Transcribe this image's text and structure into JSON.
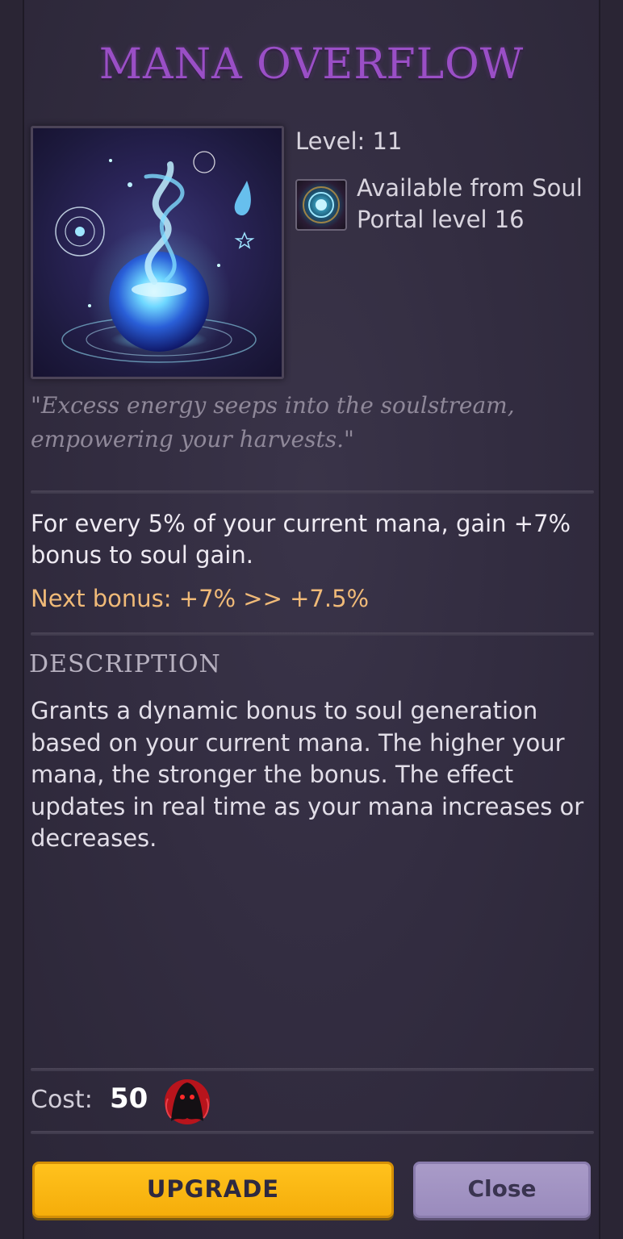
{
  "title": "Mana Overflow",
  "level": "Level: 11",
  "availability": "Available from Soul Portal level 16",
  "flavor_text": "\"Excess energy seeps into the soulstream, empowering your harvests.\"",
  "effect_text": "For every 5% of your current mana, gain +7% bonus to soul gain.",
  "next_bonus": "Next bonus: +7% >> +7.5%",
  "description_heading": "Description",
  "description_text": "Grants a dynamic bonus to soul generation based on your current mana. The higher your mana, the stronger the bonus. The effect updates in real time as your mana increases or decreases.",
  "cost": {
    "label": "Cost:",
    "value": "50",
    "currency_icon": "soul-icon"
  },
  "buttons": {
    "upgrade": "UPGRADE",
    "close": "Close"
  },
  "icons": {
    "skill": "mana-orb-icon",
    "portal": "soul-portal-icon"
  },
  "colors": {
    "title": "#9a4fc6",
    "next_bonus": "#f0ba78",
    "upgrade_button": "#ffc21d",
    "close_button": "#a99bc8"
  }
}
